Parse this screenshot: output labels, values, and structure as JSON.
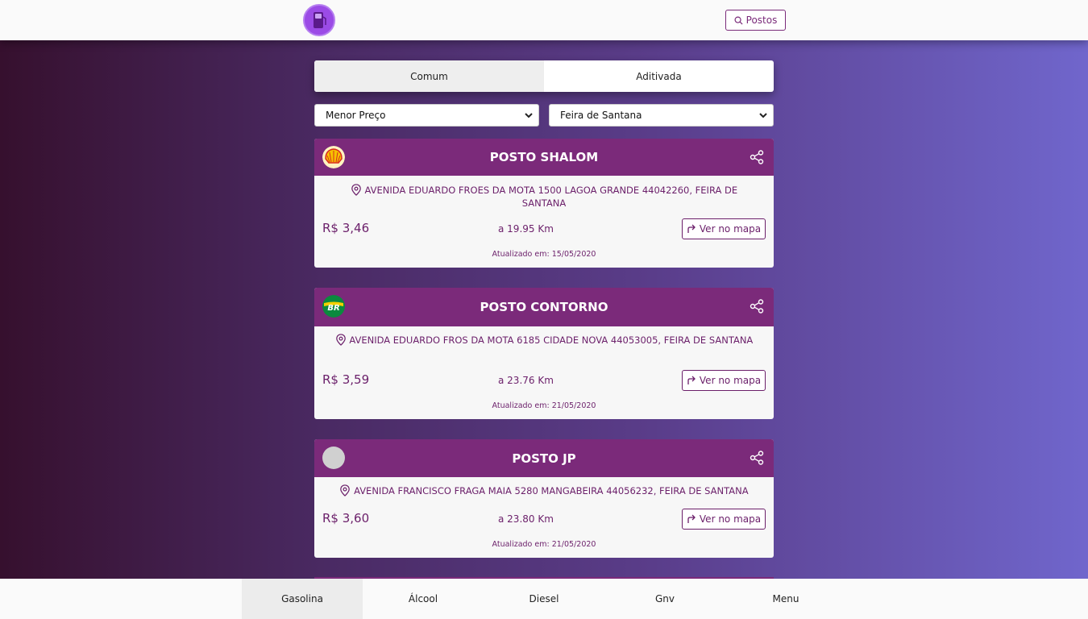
{
  "header": {
    "search_label": "Postos",
    "logo_icon": "fuel-pump-icon"
  },
  "tabs": [
    {
      "label": "Comum",
      "active": true
    },
    {
      "label": "Aditivada",
      "active": false
    }
  ],
  "filters": {
    "sort": "Menor Preço",
    "city": "Feira de Santana"
  },
  "stations": [
    {
      "name": "POSTO SHALOM",
      "brand": "shell",
      "address": "AVENIDA EDUARDO FROES DA MOTA 1500 LAGOA GRANDE 44042260, FEIRA DE SANTANA",
      "price": "R$ 3,46",
      "distance": "a 19.95 Km",
      "map_label": "Ver no mapa",
      "updated": "Atualizado em: 15/05/2020"
    },
    {
      "name": "POSTO CONTORNO",
      "brand": "br",
      "address": "AVENIDA EDUARDO FROS DA MOTA 6185 CIDADE NOVA 44053005, FEIRA DE SANTANA",
      "price": "R$ 3,59",
      "distance": "a 23.76 Km",
      "map_label": "Ver no mapa",
      "updated": "Atualizado em: 21/05/2020"
    },
    {
      "name": "POSTO JP",
      "brand": "none",
      "address": "AVENIDA FRANCISCO FRAGA MAIA 5280 MANGABEIRA 44056232, FEIRA DE SANTANA",
      "price": "R$ 3,60",
      "distance": "a 23.80 Km",
      "map_label": "Ver no mapa",
      "updated": "Atualizado em: 21/05/2020"
    }
  ],
  "bottom_nav": [
    {
      "label": "Gasolina",
      "active": true
    },
    {
      "label": "Álcool",
      "active": false
    },
    {
      "label": "Diesel",
      "active": false
    },
    {
      "label": "Gnv",
      "active": false
    },
    {
      "label": "Menu",
      "active": false
    }
  ],
  "colors": {
    "accent": "#7b2a7a",
    "text_accent": "#6b1f6a",
    "logo": "#9b4be6"
  }
}
